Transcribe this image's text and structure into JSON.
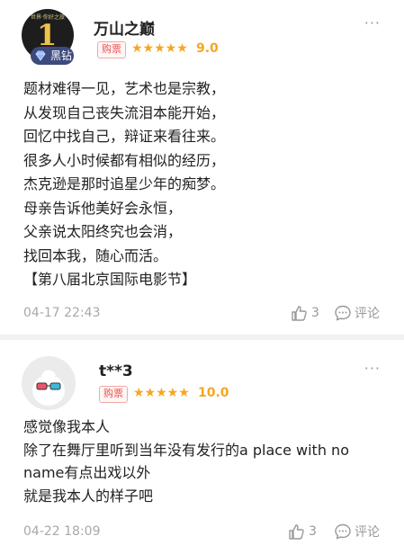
{
  "reviews": [
    {
      "username": "万山之巅",
      "avatar_badge": "1",
      "avatar_top_text": "世界·你好之旅",
      "vip_label": "黑钻",
      "ticket_tag": "购票",
      "stars": "★★★★★",
      "score": "9.0",
      "lines": [
        "题材难得一见，艺术也是宗教，",
        "从发现自己丧失流泪本能开始，",
        "回忆中找自己，辩证来看往来。",
        "很多人小时候都有相似的经历，",
        "杰克逊是那时追星少年的痴梦。",
        "母亲告诉他美好会永恒，",
        "父亲说太阳终究也会消，",
        "找回本我，随心而活。",
        "【第八届北京国际电影节】"
      ],
      "date": "04-17 22:43",
      "like_count": "3",
      "comment_label": "评论"
    },
    {
      "username": "t**3",
      "ticket_tag": "购票",
      "stars": "★★★★★",
      "score": "10.0",
      "lines": [
        "感觉像我本人",
        "除了在舞厅里听到当年没有发行的a place with no",
        "name有点出戏以外",
        "就是我本人的样子吧"
      ],
      "date": "04-22 18:09",
      "like_count": "3",
      "comment_label": "评论"
    }
  ],
  "colors": {
    "star": "#f5a623",
    "ticket_tag": "#e8504d",
    "vip_badge": "#3c4a7c"
  },
  "icons": [
    "more-icon",
    "like-icon",
    "comment-icon",
    "diamond-icon"
  ]
}
